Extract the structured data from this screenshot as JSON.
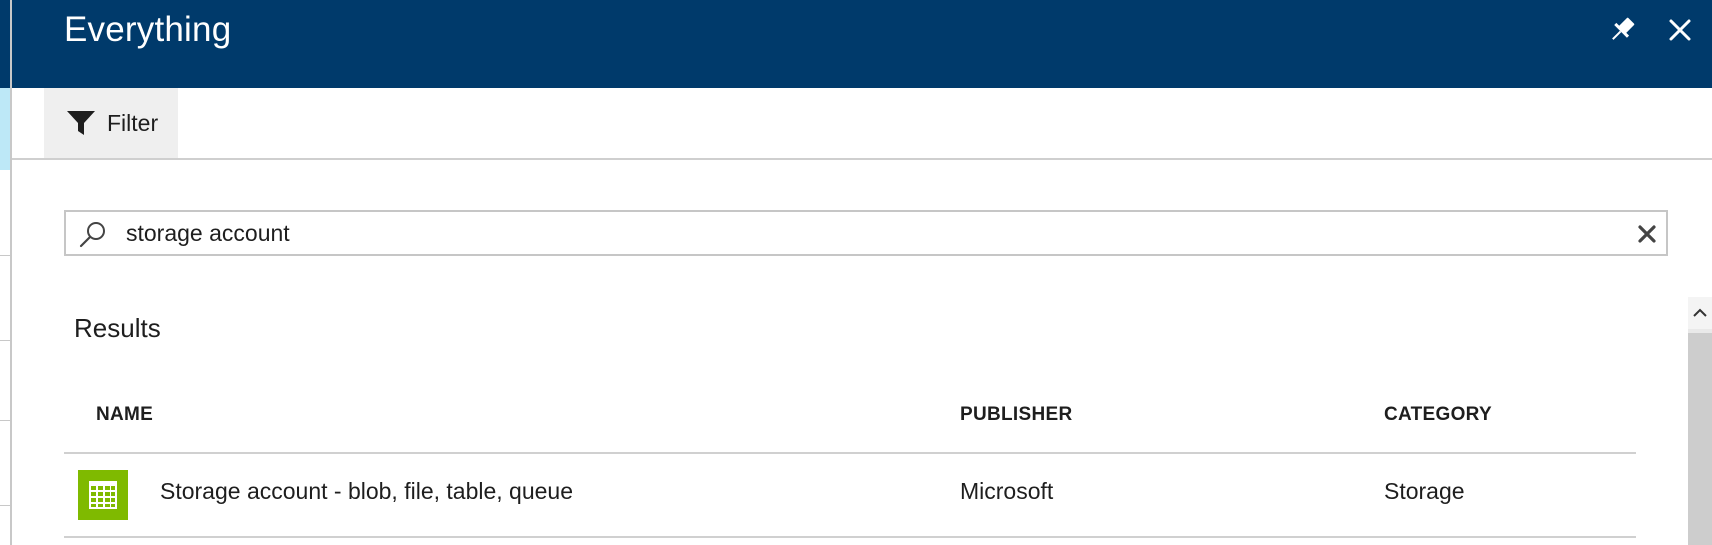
{
  "blade": {
    "title": "Everything",
    "pin_icon": "pin-icon",
    "close_icon": "close-icon"
  },
  "command_bar": {
    "filter_label": "Filter",
    "filter_icon": "funnel-icon"
  },
  "search": {
    "value": "storage account",
    "icon": "search-icon",
    "clear_icon": "clear-icon"
  },
  "results": {
    "heading": "Results",
    "columns": [
      "NAME",
      "PUBLISHER",
      "CATEGORY"
    ],
    "rows": [
      {
        "name": "Storage account - blob, file, table, queue",
        "publisher": "Microsoft",
        "category": "Storage",
        "icon": "storage-table-icon",
        "icon_color": "#7fba00"
      }
    ]
  },
  "colors": {
    "header_bg": "#003a6b",
    "accent_green": "#7fba00",
    "left_selection": "#bde8f7"
  }
}
